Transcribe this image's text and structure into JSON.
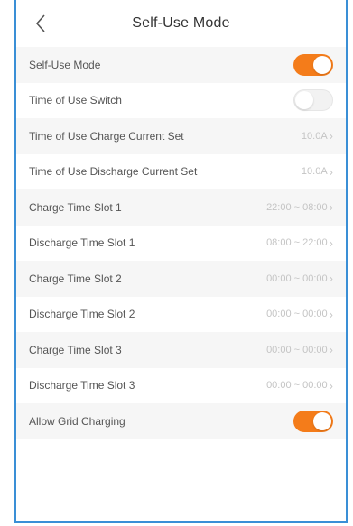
{
  "header": {
    "title": "Self-Use Mode"
  },
  "rows": [
    {
      "label": "Self-Use Mode",
      "toggle": true
    },
    {
      "label": "Time of Use Switch",
      "toggle": false
    },
    {
      "label": "Time of Use Charge Current Set",
      "value": "10.0A"
    },
    {
      "label": "Time of Use Discharge Current Set",
      "value": "10.0A"
    },
    {
      "label": "Charge Time Slot 1",
      "value": "22:00 ~ 08:00"
    },
    {
      "label": "Discharge Time Slot 1",
      "value": "08:00 ~ 22:00"
    },
    {
      "label": "Charge Time Slot 2",
      "value": "00:00 ~ 00:00"
    },
    {
      "label": "Discharge Time Slot 2",
      "value": "00:00 ~ 00:00"
    },
    {
      "label": "Charge Time Slot 3",
      "value": "00:00 ~ 00:00"
    },
    {
      "label": "Discharge Time Slot 3",
      "value": "00:00 ~ 00:00"
    },
    {
      "label": "Allow Grid Charging",
      "toggle": true
    }
  ],
  "colors": {
    "accent": "#f47c1a",
    "frame": "#3a8fd6"
  }
}
